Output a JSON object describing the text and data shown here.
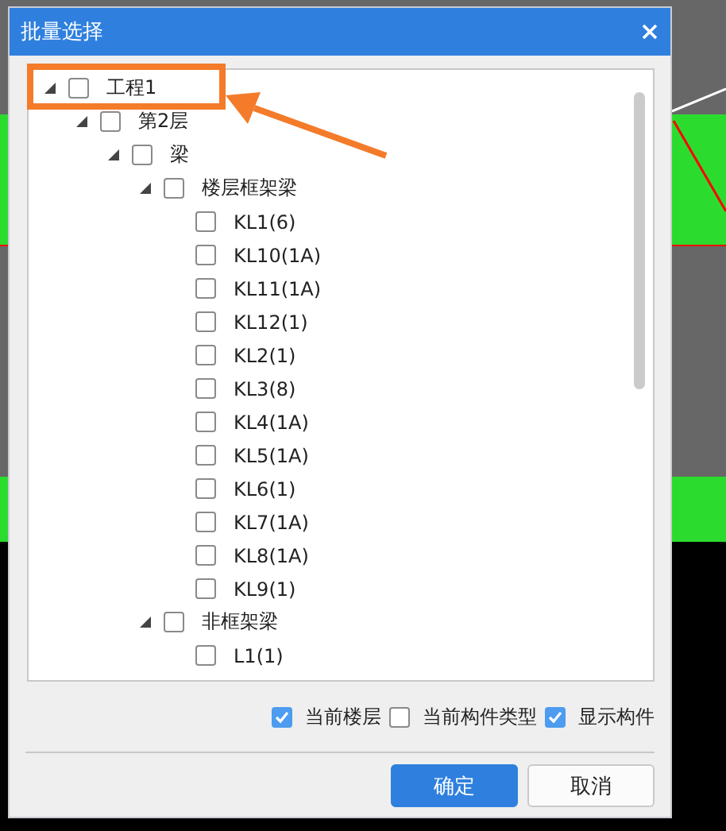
{
  "window": {
    "title": "批量选择"
  },
  "tree": [
    {
      "label": "工程1",
      "checked": false,
      "expanded": true,
      "children": [
        {
          "label": "第2层",
          "checked": false,
          "expanded": true,
          "children": [
            {
              "label": "梁",
              "checked": false,
              "expanded": true,
              "children": [
                {
                  "label": "楼层框架梁",
                  "checked": false,
                  "expanded": true,
                  "children": [
                    {
                      "label": "KL1(6)",
                      "checked": false
                    },
                    {
                      "label": "KL10(1A)",
                      "checked": false
                    },
                    {
                      "label": "KL11(1A)",
                      "checked": false
                    },
                    {
                      "label": "KL12(1)",
                      "checked": false
                    },
                    {
                      "label": "KL2(1)",
                      "checked": false
                    },
                    {
                      "label": "KL3(8)",
                      "checked": false
                    },
                    {
                      "label": "KL4(1A)",
                      "checked": false
                    },
                    {
                      "label": "KL5(1A)",
                      "checked": false
                    },
                    {
                      "label": "KL6(1)",
                      "checked": false
                    },
                    {
                      "label": "KL7(1A)",
                      "checked": false
                    },
                    {
                      "label": "KL8(1A)",
                      "checked": false
                    },
                    {
                      "label": "KL9(1)",
                      "checked": false
                    }
                  ]
                },
                {
                  "label": "非框架梁",
                  "checked": false,
                  "expanded": true,
                  "children": [
                    {
                      "label": "L1(1)",
                      "checked": false
                    }
                  ]
                }
              ]
            }
          ]
        }
      ]
    }
  ],
  "options": [
    {
      "label": "当前楼层",
      "checked": true
    },
    {
      "label": "当前构件类型",
      "checked": false
    },
    {
      "label": "显示构件",
      "checked": true
    }
  ],
  "buttons": [
    {
      "label": "确定",
      "kind": "primary"
    },
    {
      "label": "取消",
      "kind": "secondary"
    }
  ]
}
